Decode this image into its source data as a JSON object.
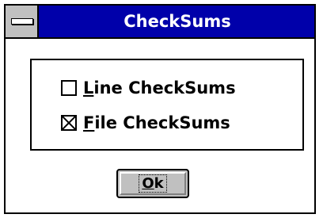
{
  "window": {
    "title": "CheckSums",
    "title_bar_color": "#0000aa",
    "system_menu_icon": "system-menu-icon"
  },
  "options": [
    {
      "mnemonic": "L",
      "rest": "ine CheckSums",
      "checked": false
    },
    {
      "mnemonic": "F",
      "rest": "ile CheckSums",
      "checked": true
    }
  ],
  "ok_button": {
    "mnemonic": "O",
    "rest": "k"
  }
}
